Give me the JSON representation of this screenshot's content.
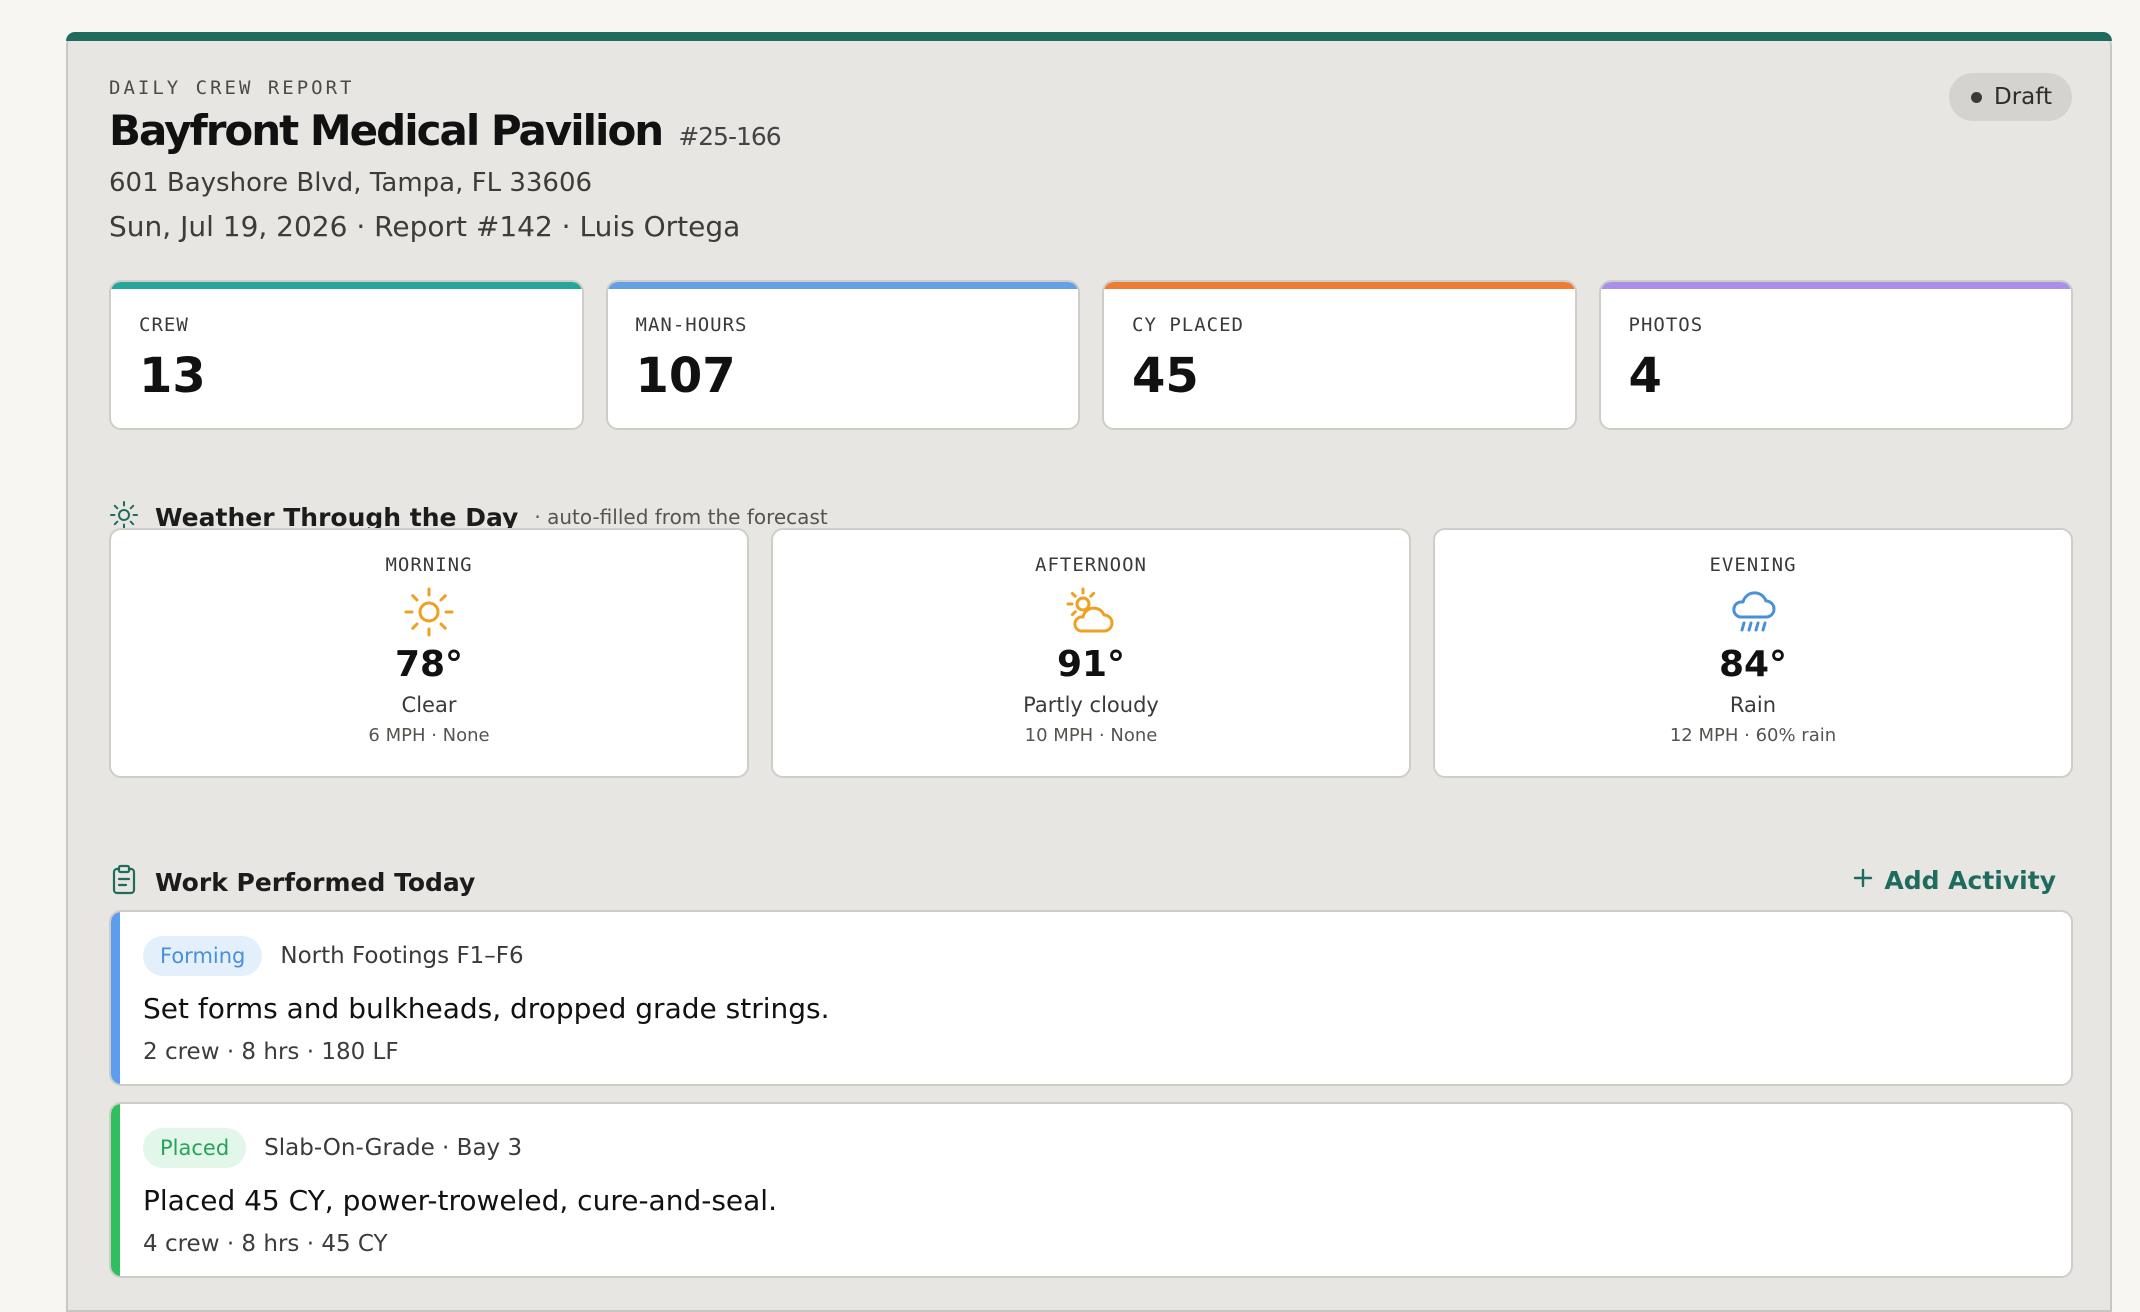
{
  "report": {
    "eyebrow": "DAILY CREW REPORT",
    "title": "Bayfront Medical Pavilion",
    "job_number": "#25-166",
    "address": "601 Bayshore Blvd, Tampa, FL 33606",
    "meta": "Sun, Jul 19, 2026 · Report #142 · Luis Ortega",
    "status_badge": "Draft",
    "accent_color": "#1f6b5e"
  },
  "stats": [
    {
      "label": "CREW",
      "value": "13",
      "color": "#26a69a"
    },
    {
      "label": "MAN-HOURS",
      "value": "107",
      "color": "#64a0e6"
    },
    {
      "label": "CY PLACED",
      "value": "45",
      "color": "#ed7d32"
    },
    {
      "label": "PHOTOS",
      "value": "4",
      "color": "#a98fe8"
    }
  ],
  "weather": {
    "title": "Weather Through the Day",
    "subtitle": "· auto-filled from the forecast",
    "icon": "sun-icon",
    "periods": [
      {
        "period": "MORNING",
        "icon": "sun-icon",
        "temp": "78°",
        "condition": "Clear",
        "detail": "6 MPH · None"
      },
      {
        "period": "AFTERNOON",
        "icon": "partly-cloudy-icon",
        "temp": "91°",
        "condition": "Partly cloudy",
        "detail": "10 MPH · None"
      },
      {
        "period": "EVENING",
        "icon": "rain-cloud-icon",
        "temp": "84°",
        "condition": "Rain",
        "detail": "12 MPH · 60% rain"
      }
    ]
  },
  "work": {
    "title": "Work Performed Today",
    "icon": "clipboard-icon",
    "add_label": "Add Activity",
    "activities": [
      {
        "tag": "Forming",
        "tag_color": "#4a90d9",
        "tag_bg": "#e3f0fc",
        "bar_color": "#5c9ded",
        "location": "North Footings F1–F6",
        "description": "Set forms and bulkheads, dropped grade strings.",
        "meta": "2 crew · 8 hrs · 180 LF"
      },
      {
        "tag": "Placed",
        "tag_color": "#27a35a",
        "tag_bg": "#e2f6e9",
        "bar_color": "#2fbf5f",
        "location": "Slab-On-Grade · Bay 3",
        "description": "Placed 45 CY, power-troweled, cure-and-seal.",
        "meta": "4 crew · 8 hrs · 45 CY"
      }
    ]
  }
}
